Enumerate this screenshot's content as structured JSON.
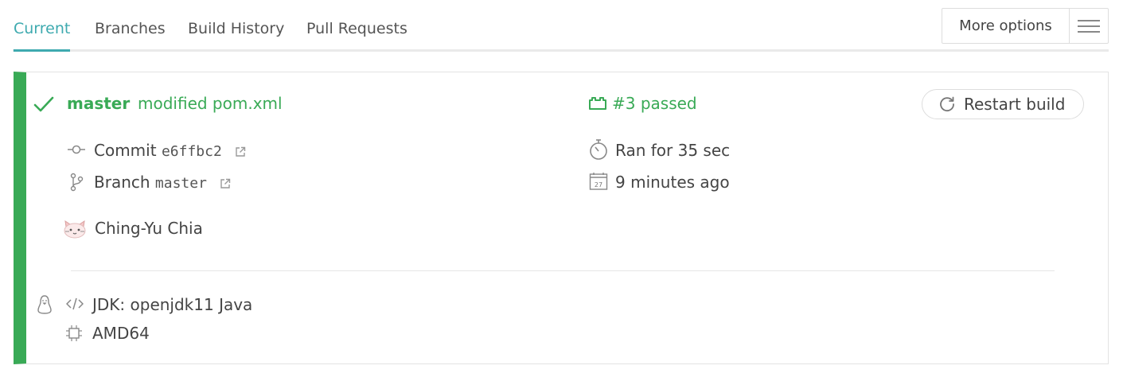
{
  "tabs": [
    {
      "label": "Current",
      "active": true
    },
    {
      "label": "Branches"
    },
    {
      "label": "Build History"
    },
    {
      "label": "Pull Requests"
    }
  ],
  "more_options": {
    "label": "More options",
    "icon": "hamburger-menu-icon"
  },
  "build": {
    "status": "passed",
    "status_color": "#39aa56",
    "branch_name": "master",
    "commit_message": "modified pom.xml",
    "build_status_text": "#3 passed",
    "restart_label": "Restart build",
    "commit_label": "Commit",
    "commit_sha": "e6ffbc2",
    "branch_label": "Branch",
    "branch_value": "master",
    "duration_text": "Ran for 35 sec",
    "finished_text": "9 minutes ago",
    "calendar_day": "27",
    "author_name": "Ching-Yu Chia",
    "jdk_text": "JDK: openjdk11 Java",
    "arch_text": "AMD64",
    "os_icon": "linux-tux-icon"
  },
  "colors": {
    "accent_tab": "#3eaaaf",
    "passed_green": "#39aa56"
  }
}
